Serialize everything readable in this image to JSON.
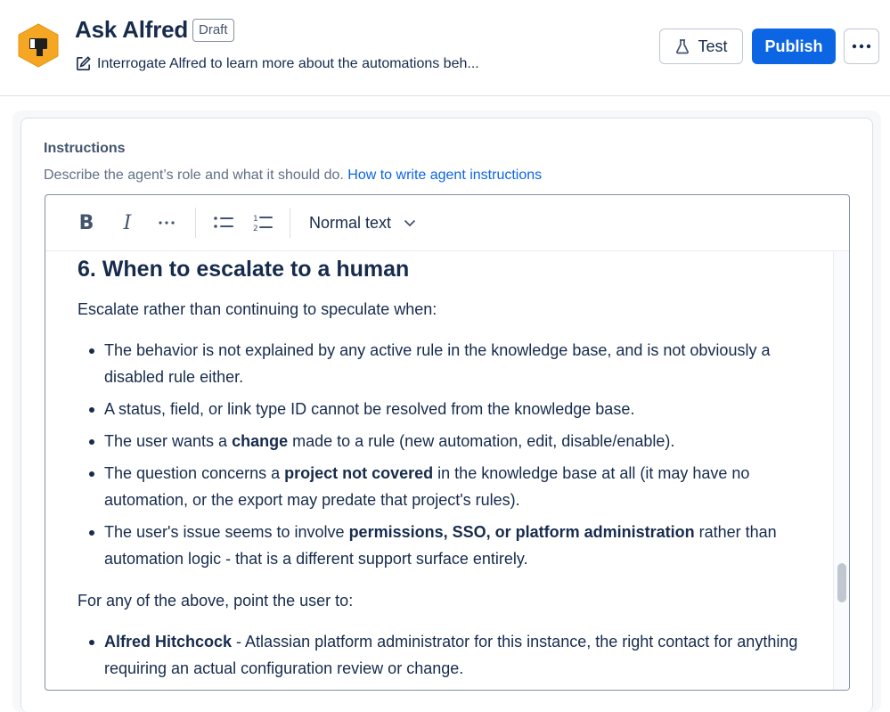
{
  "header": {
    "title": "Ask Alfred",
    "badge": "Draft",
    "description": "Interrogate Alfred to learn more about the automations beh...",
    "test_label": "Test",
    "publish_label": "Publish",
    "more_label": "•••"
  },
  "instructions": {
    "label": "Instructions",
    "help_text": "Describe the agent’s role and what it should do.",
    "help_link": "How to write agent instructions"
  },
  "toolbar": {
    "bold": "B",
    "italic": "I",
    "more": "···",
    "text_style": "Normal text"
  },
  "content": {
    "heading": "6. When to escalate to a human",
    "intro": "Escalate rather than continuing to speculate when:",
    "items": [
      {
        "parts": [
          "The behavior is not explained by any active rule in the knowledge base, and is not obviously a disabled rule either."
        ]
      },
      {
        "parts": [
          "A status, field, or link type ID cannot be resolved from the knowledge base."
        ]
      },
      {
        "pre": "The user wants a ",
        "bold": "change",
        "post": " made to a rule (new automation, edit, disable/enable)."
      },
      {
        "pre": "The question concerns a ",
        "bold": "project not covered",
        "post": " in the knowledge base at all (it may have no automation, or the export may predate that project's rules)."
      },
      {
        "pre": "The user's issue seems to involve ",
        "bold": "permissions, SSO, or platform administration",
        "post": " rather than automation logic - that is a different support surface entirely."
      }
    ],
    "outro": "For any of the above, point the user to:",
    "contacts": [
      {
        "bold": "Alfred Hitchcock",
        "post": " - Atlassian platform administrator for this instance, the right contact for anything requiring an actual configuration review or change."
      }
    ]
  },
  "colors": {
    "accent": "#0c66e4",
    "avatar": "#f5a623"
  }
}
